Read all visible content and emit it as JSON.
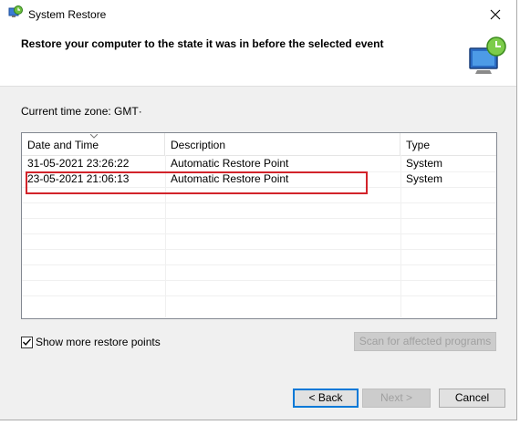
{
  "window": {
    "title": "System Restore"
  },
  "header": {
    "heading": "Restore your computer to the state it was in before the selected event"
  },
  "content": {
    "timezone_label": "Current time zone: GMT·",
    "columns": [
      "Date and Time",
      "Description",
      "Type"
    ],
    "rows": [
      {
        "date": "31-05-2021 23:26:22",
        "description": "Automatic Restore Point",
        "type": "System"
      },
      {
        "date": "23-05-2021 21:06:13",
        "description": "Automatic Restore Point",
        "type": "System"
      }
    ],
    "show_more_label": "Show more restore points",
    "show_more_checked": true,
    "scan_button": "Scan for affected programs"
  },
  "footer": {
    "back": "< Back",
    "next": "Next >",
    "cancel": "Cancel"
  },
  "colors": {
    "highlight": "#d2232a",
    "accent": "#0078d7"
  }
}
